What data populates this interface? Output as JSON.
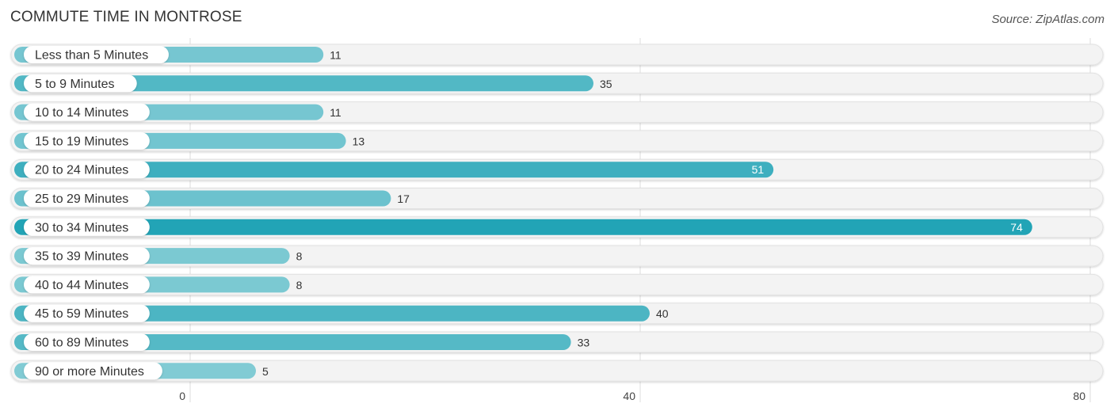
{
  "chart_data": {
    "type": "bar",
    "orientation": "horizontal",
    "title": "COMMUTE TIME IN MONTROSE",
    "source": "Source: ZipAtlas.com",
    "categories": [
      "Less than 5 Minutes",
      "5 to 9 Minutes",
      "10 to 14 Minutes",
      "15 to 19 Minutes",
      "20 to 24 Minutes",
      "25 to 29 Minutes",
      "30 to 34 Minutes",
      "35 to 39 Minutes",
      "40 to 44 Minutes",
      "45 to 59 Minutes",
      "60 to 89 Minutes",
      "90 or more Minutes"
    ],
    "values": [
      11,
      35,
      11,
      13,
      51,
      17,
      74,
      8,
      8,
      40,
      33,
      5
    ],
    "xlabel": "",
    "ylabel": "",
    "xlim": [
      0,
      80
    ],
    "xticks": [
      0,
      40,
      80
    ],
    "grid": true,
    "colors": {
      "low": "#8dd0d8",
      "high": "#22a4b6",
      "track": "#f3f3f3"
    }
  }
}
